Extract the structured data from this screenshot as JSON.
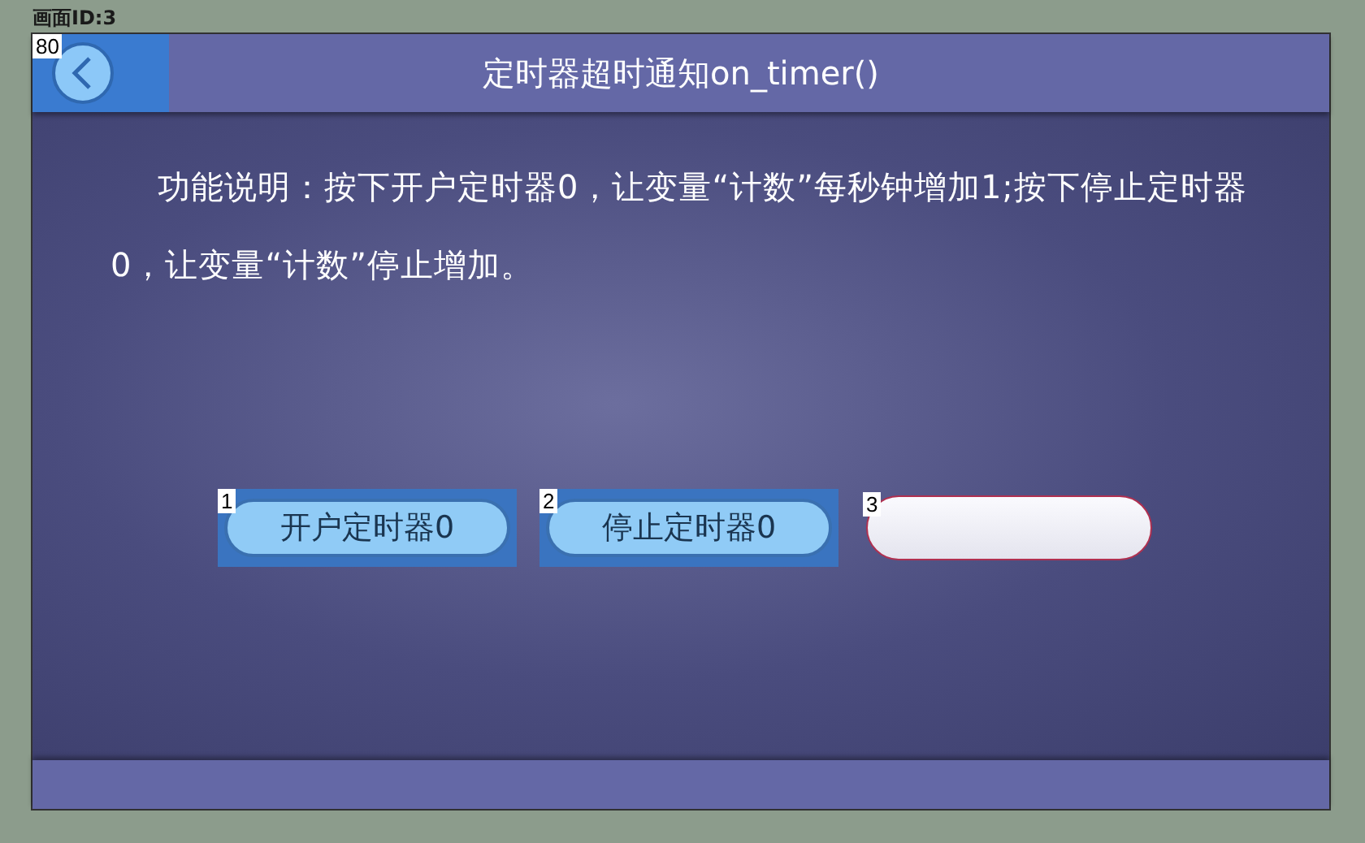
{
  "screen_label": "画面ID:3",
  "header": {
    "back_tag": "80",
    "title": "定时器超时通知on_timer()"
  },
  "description": "功能说明：按下开户定时器0，让变量“计数”每秒钟增加1;按下停止定时器0，让变量“计数”停止增加。",
  "controls": [
    {
      "kind": "button",
      "tag": "1",
      "label": "开户定时器0"
    },
    {
      "kind": "button",
      "tag": "2",
      "label": "停止定时器0"
    },
    {
      "kind": "display",
      "tag": "3"
    }
  ]
}
